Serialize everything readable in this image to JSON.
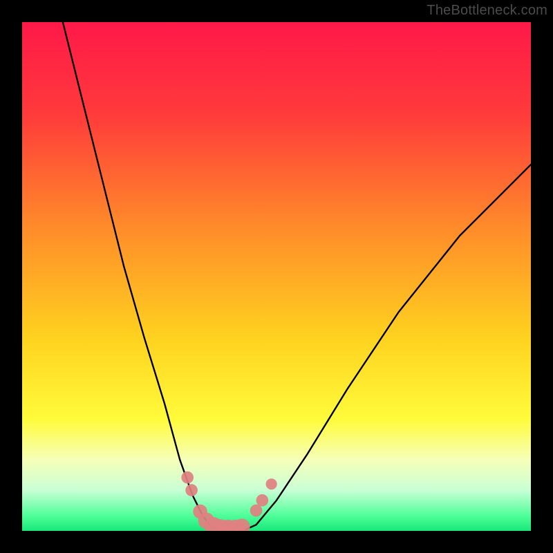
{
  "watermark": "TheBottleneck.com",
  "chart_data": {
    "type": "line",
    "title": "",
    "xlabel": "",
    "ylabel": "",
    "xlim": [
      0,
      100
    ],
    "ylim": [
      0,
      100
    ],
    "gradient_stops": [
      {
        "pct": 0,
        "color": "#ff1949"
      },
      {
        "pct": 18,
        "color": "#ff3a3b"
      },
      {
        "pct": 40,
        "color": "#ff8a2a"
      },
      {
        "pct": 62,
        "color": "#ffd21f"
      },
      {
        "pct": 78,
        "color": "#fffb3a"
      },
      {
        "pct": 86,
        "color": "#f6ffb8"
      },
      {
        "pct": 92,
        "color": "#c9ffd6"
      },
      {
        "pct": 97,
        "color": "#4fff99"
      },
      {
        "pct": 100,
        "color": "#17e87a"
      }
    ],
    "series": [
      {
        "name": "left-arm",
        "x": [
          8,
          12,
          16,
          20,
          24,
          28,
          31,
          33.5,
          35.5,
          37
        ],
        "y": [
          100,
          84,
          68,
          52,
          38,
          25,
          14,
          7,
          3,
          1
        ]
      },
      {
        "name": "trough",
        "x": [
          37,
          38.5,
          40,
          42,
          44,
          46
        ],
        "y": [
          1,
          0.2,
          0,
          0,
          0.3,
          1.2
        ]
      },
      {
        "name": "right-arm",
        "x": [
          46,
          50,
          56,
          64,
          74,
          86,
          100
        ],
        "y": [
          1.2,
          6,
          15,
          28,
          43,
          58,
          72
        ]
      }
    ],
    "markers": {
      "comment": "salmon dots/blobs near the valley",
      "color": "#e08080",
      "points": [
        {
          "x": 32.5,
          "y": 10.5,
          "r": 1.2
        },
        {
          "x": 33.3,
          "y": 8.0,
          "r": 1.2
        },
        {
          "x": 35.0,
          "y": 3.8,
          "r": 1.4
        },
        {
          "x": 36.2,
          "y": 2.0,
          "r": 1.6
        },
        {
          "x": 37.6,
          "y": 0.9,
          "r": 1.8
        },
        {
          "x": 39.0,
          "y": 0.4,
          "r": 1.9
        },
        {
          "x": 40.5,
          "y": 0.2,
          "r": 2.0
        },
        {
          "x": 42.0,
          "y": 0.3,
          "r": 1.9
        },
        {
          "x": 43.2,
          "y": 0.8,
          "r": 1.6
        },
        {
          "x": 46.0,
          "y": 4.0,
          "r": 1.2
        },
        {
          "x": 47.2,
          "y": 6.0,
          "r": 1.2
        },
        {
          "x": 49.0,
          "y": 9.2,
          "r": 1.1
        }
      ]
    }
  }
}
